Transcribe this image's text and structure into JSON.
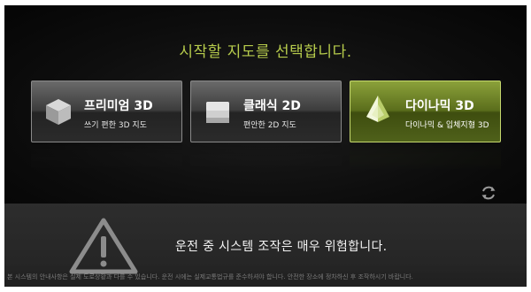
{
  "prompt": "시작할 지도를 선택합니다.",
  "modes": [
    {
      "title": "프리미엄 3D",
      "subtitle": "쓰기 편한 3D 지도",
      "icon": "cube-3d-icon",
      "active": false
    },
    {
      "title": "클래식 2D",
      "subtitle": "편안한 2D 지도",
      "icon": "flat-map-2d-icon",
      "active": false
    },
    {
      "title": "다이나믹 3D",
      "subtitle": "다이나믹 & 입체지형 3D",
      "icon": "pyramid-3d-icon",
      "active": true
    }
  ],
  "refresh_icon": "refresh-icon",
  "warning": {
    "icon": "warning-triangle-icon",
    "text": "운전 중 시스템 조작은 매우 위험합니다."
  },
  "footer": "본 시스템의 안내사항은 실제 도로상황과 다를 수 있습니다.  운전 시에는 실제교통법규를 준수하셔야 합니다.  안전한 장소에 정차하신 후 조작하시기 바랍니다.",
  "colors": {
    "accent": "#b7cc4c",
    "active_card": "#5b6e1c",
    "background": "#0a0a0a"
  }
}
